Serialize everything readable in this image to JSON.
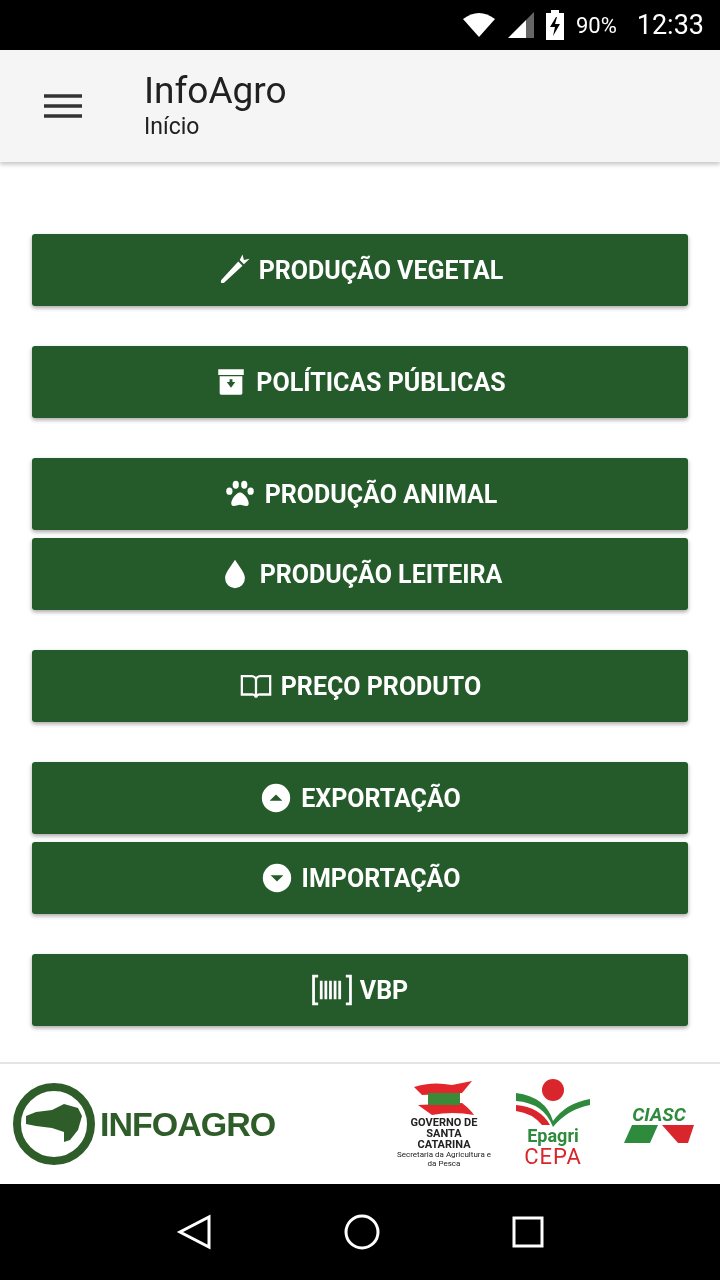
{
  "status_bar": {
    "battery": "90%",
    "time": "12:33"
  },
  "app_bar": {
    "title": "InfoAgro",
    "subtitle": "Início"
  },
  "button_groups": [
    [
      {
        "label": "PRODUÇÃO VEGETAL"
      }
    ],
    [
      {
        "label": "POLÍTICAS PÚBLICAS"
      }
    ],
    [
      {
        "label": "PRODUÇÃO ANIMAL"
      },
      {
        "label": "PRODUÇÃO LEITEIRA"
      }
    ],
    [
      {
        "label": "PREÇO PRODUTO"
      }
    ],
    [
      {
        "label": "EXPORTAÇÃO"
      },
      {
        "label": "IMPORTAÇÃO"
      }
    ],
    [
      {
        "label": "VBP"
      }
    ]
  ],
  "footer": {
    "infoagro": "INFOAGRO",
    "governo": "GOVERNO DE SANTA CATARINA",
    "secretaria": "Secretaria da Agricultura e da Pesca",
    "epagri": "Epagri",
    "cepa": "CEPA",
    "ciasc": "CIASC"
  }
}
